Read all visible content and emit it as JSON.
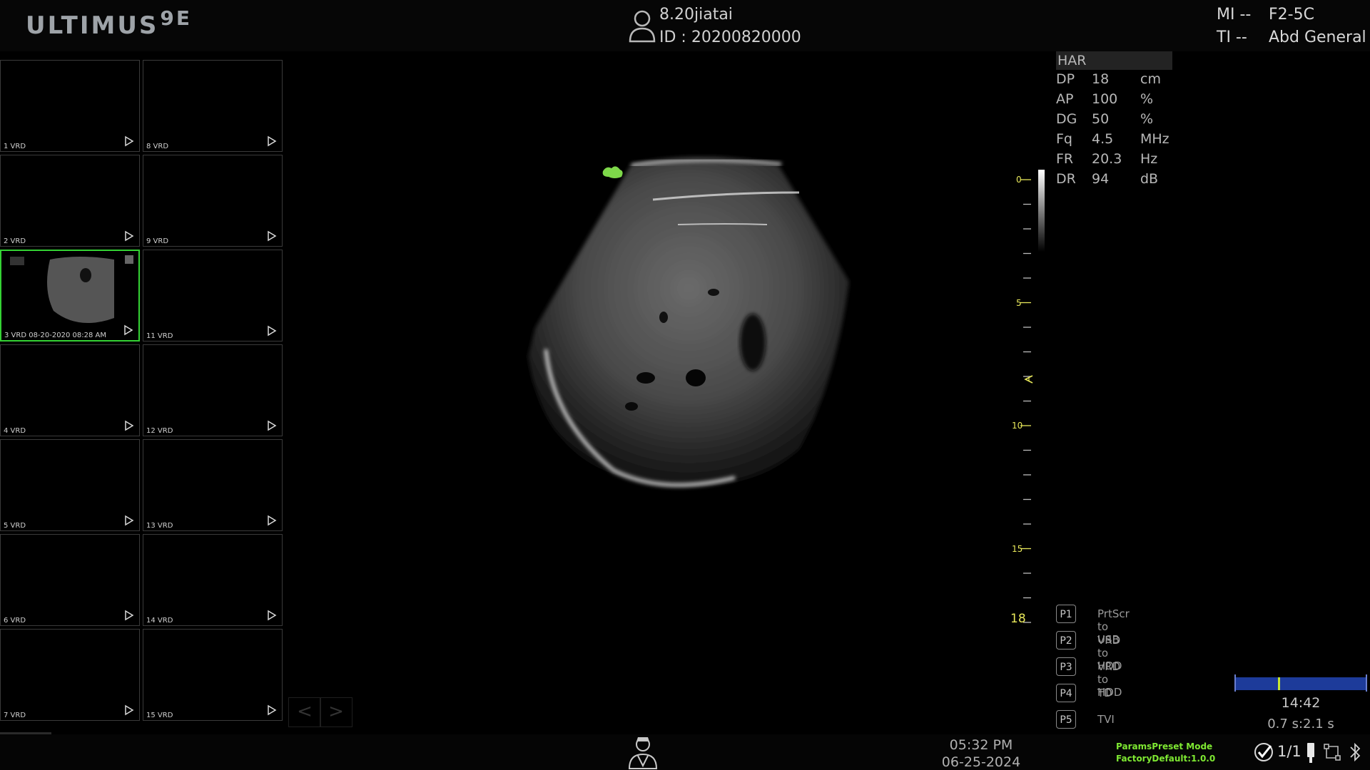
{
  "header": {
    "logo": "ULTIMUS",
    "logo_model": "9E",
    "patient_name": "8.20jiatai",
    "patient_id": "ID :  20200820000",
    "mi": "MI --",
    "ti": "TI --",
    "probe": "F2-5C",
    "preset": "Abd General"
  },
  "thumbnails": [
    {
      "label": "1 VRD",
      "col": 0,
      "row": 0
    },
    {
      "label": "8 VRD",
      "col": 1,
      "row": 0
    },
    {
      "label": "2 VRD",
      "col": 0,
      "row": 1
    },
    {
      "label": "9 VRD",
      "col": 1,
      "row": 1
    },
    {
      "label": "3 VRD 08-20-2020 08:28 AM",
      "col": 0,
      "row": 2,
      "selected": true
    },
    {
      "label": "11 VRD",
      "col": 1,
      "row": 2
    },
    {
      "label": "4 VRD",
      "col": 0,
      "row": 3
    },
    {
      "label": "12 VRD",
      "col": 1,
      "row": 3
    },
    {
      "label": "5 VRD",
      "col": 0,
      "row": 4
    },
    {
      "label": "13 VRD",
      "col": 1,
      "row": 4
    },
    {
      "label": "6 VRD",
      "col": 0,
      "row": 5
    },
    {
      "label": "14 VRD",
      "col": 1,
      "row": 5
    },
    {
      "label": "7 VRD",
      "col": 0,
      "row": 6
    },
    {
      "label": "15 VRD",
      "col": 1,
      "row": 6
    }
  ],
  "pager": {
    "prev": "<",
    "next": ">"
  },
  "depth": {
    "labels": [
      "0",
      "5",
      "10",
      "15"
    ],
    "max": "18"
  },
  "params": {
    "mode": "HAR",
    "rows": [
      {
        "name": "DP",
        "value": "18",
        "unit": "cm"
      },
      {
        "name": "AP",
        "value": "100",
        "unit": "%"
      },
      {
        "name": "DG",
        "value": "50",
        "unit": "%"
      },
      {
        "name": "Fq",
        "value": "4.5",
        "unit": "MHz"
      },
      {
        "name": "FR",
        "value": "20.3",
        "unit": "Hz"
      },
      {
        "name": "DR",
        "value": "94",
        "unit": "dB"
      }
    ]
  },
  "presets": [
    {
      "key": "P1",
      "label": "PrtScr to USB"
    },
    {
      "key": "P2",
      "label": "VRD to HDD"
    },
    {
      "key": "P3",
      "label": "VRD to HDD"
    },
    {
      "key": "P4",
      "label": "TD"
    },
    {
      "key": "P5",
      "label": "TVI"
    }
  ],
  "cine": {
    "time": "14:42",
    "speed": "0.7 s:2.1 s",
    "position": 0.33
  },
  "footer": {
    "time": "05:32 PM",
    "date": "06-25-2024",
    "params_mode": "ParamsPreset Mode",
    "factory": "FactoryDefault:1.0.0",
    "pages": "1/1"
  },
  "colors": {
    "selected": "#34d234",
    "depth_labels": "#e8e85a",
    "status_green": "#7ee832",
    "cine_bar": "#1d3b9a"
  }
}
